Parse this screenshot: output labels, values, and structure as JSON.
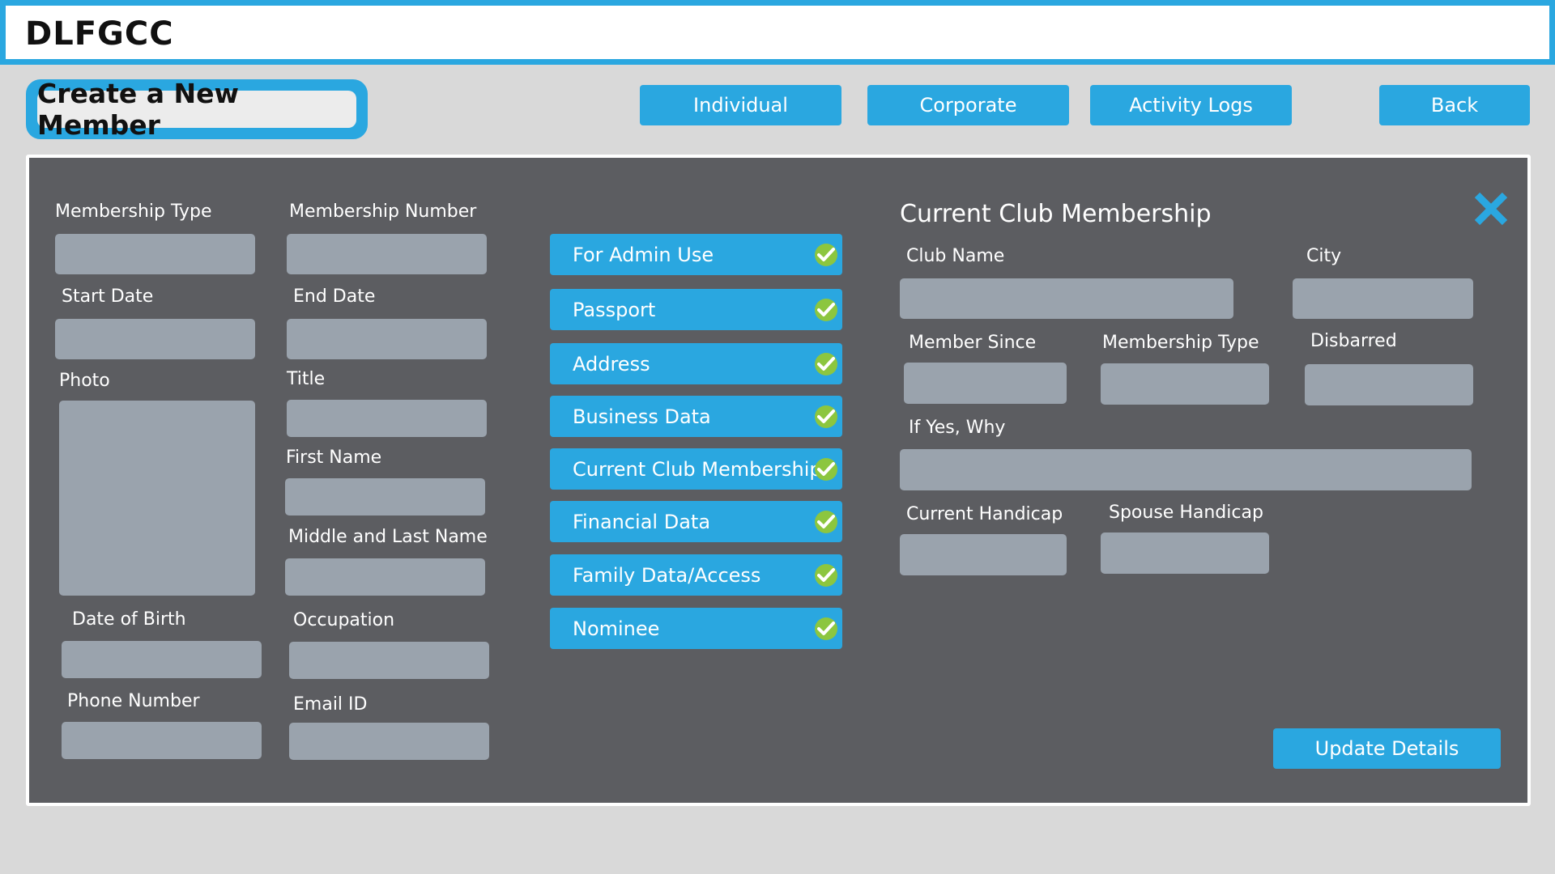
{
  "header": {
    "app_title": "DLFGCC"
  },
  "page": {
    "heading": "Create a New Member"
  },
  "nav": {
    "individual": "Individual",
    "corporate": "Corporate",
    "activity_logs": "Activity Logs",
    "back": "Back"
  },
  "form": {
    "membership_type": "Membership Type",
    "membership_number": "Membership Number",
    "start_date": "Start Date",
    "end_date": "End Date",
    "photo": "Photo",
    "title": "Title",
    "first_name": "First Name",
    "middle_last_name": "Middle and Last Name",
    "date_of_birth": "Date of Birth",
    "occupation": "Occupation",
    "phone_number": "Phone Number",
    "email_id": "Email ID"
  },
  "sections": [
    {
      "label": "For Admin Use",
      "icon": "check-circle-icon"
    },
    {
      "label": "Passport",
      "icon": "check-circle-icon"
    },
    {
      "label": "Address",
      "icon": "check-circle-icon"
    },
    {
      "label": "Business Data",
      "icon": "check-circle-icon"
    },
    {
      "label": "Current Club Membership",
      "icon": "check-circle-icon"
    },
    {
      "label": "Financial Data",
      "icon": "check-circle-icon"
    },
    {
      "label": "Family Data/Access",
      "icon": "check-circle-icon"
    },
    {
      "label": "Nominee",
      "icon": "check-circle-icon"
    }
  ],
  "club": {
    "heading": "Current Club Membership",
    "club_name": "Club Name",
    "city": "City",
    "member_since": "Member Since",
    "membership_type": "Membership Type",
    "disbarred": "Disbarred",
    "if_yes_why": "If Yes, Why",
    "current_handicap": "Current Handicap",
    "spouse_handicap": "Spouse Handicap",
    "update_label": "Update Details"
  },
  "colors": {
    "accent": "#2aa7e0",
    "panel": "#5c5d61",
    "field": "#9aa3ad",
    "check": "#8cc63f",
    "background": "#d9d9d9"
  }
}
